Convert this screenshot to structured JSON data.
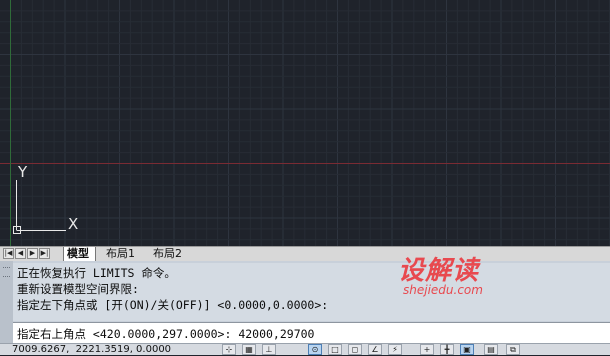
{
  "tabs": {
    "nav": [
      "|◀",
      "◀",
      "▶",
      "▶|"
    ],
    "items": [
      "模型",
      "布局1",
      "布局2"
    ],
    "active_index": 0
  },
  "command": {
    "history": [
      "正在恢复执行 LIMITS 命令。",
      "重新设置模型空间界限:",
      "指定左下角点或 [开(ON)/关(OFF)] <0.0000,0.0000>:"
    ],
    "input": "指定右上角点 <420.0000,297.0000>: 42000,29700"
  },
  "watermark": {
    "title": "设解读",
    "url": "shejiedu.com"
  },
  "status": {
    "coordinates": "7009.6267,  2221.3519, 0.0000",
    "buttons": [
      {
        "name": "snap-toggle-icon",
        "glyph": "⊹",
        "on": false
      },
      {
        "name": "grid-display-icon",
        "glyph": "▦",
        "on": false
      },
      {
        "name": "ortho-toggle-icon",
        "glyph": "⊥",
        "on": false
      },
      {
        "name": "polar-tracking-icon",
        "glyph": "⊙",
        "on": true
      },
      {
        "name": "object-snap-icon",
        "glyph": "□",
        "on": false
      },
      {
        "name": "3d-object-snap-icon",
        "glyph": "◻",
        "on": false
      },
      {
        "name": "object-snap-tracking-icon",
        "glyph": "∠",
        "on": false
      },
      {
        "name": "dynamic-ucs-icon",
        "glyph": "⚡",
        "on": false
      },
      {
        "name": "dynamic-input-icon",
        "glyph": "+",
        "on": false
      },
      {
        "name": "lineweight-icon",
        "glyph": "╋",
        "on": false
      },
      {
        "name": "transparency-icon",
        "glyph": "▣",
        "on": true
      },
      {
        "name": "quick-properties-icon",
        "glyph": "▤",
        "on": false
      },
      {
        "name": "selection-cycling-icon",
        "glyph": "⧉",
        "on": false
      }
    ]
  },
  "canvas": {
    "background": "#1f232b",
    "grid_minor": "#272c35",
    "grid_major": "#2e343f",
    "x_axis_color": "#7a2b33",
    "y_axis_color": "#2f6b39",
    "ucs_label_y": "Y",
    "ucs_label_x": "X"
  }
}
